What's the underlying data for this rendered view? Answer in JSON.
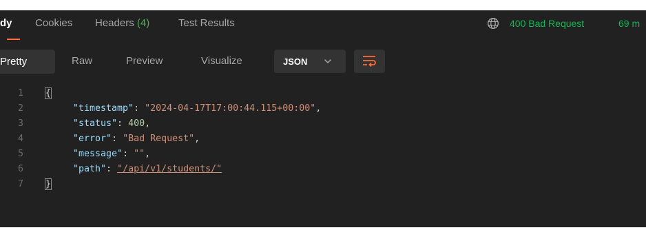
{
  "tabs": {
    "body": "dy",
    "cookies": "Cookies",
    "headers_label": "Headers",
    "headers_count": "(4)",
    "test_results": "Test Results"
  },
  "status": {
    "code_text": "400 Bad Request",
    "time": "69 m"
  },
  "toolbar": {
    "pretty": "Pretty",
    "raw": "Raw",
    "preview": "Preview",
    "visualize": "Visualize",
    "format": "JSON"
  },
  "icons": {
    "globe": "globe-icon",
    "chevron": "chevron-down-icon",
    "wrap": "wrap-lines-icon"
  },
  "colors": {
    "background": "#212121",
    "active_tab_underline": "#ff6c37",
    "status_ok_text": "#0cbb52"
  },
  "code": {
    "line_numbers": [
      "1",
      "2",
      "3",
      "4",
      "5",
      "6",
      "7"
    ],
    "open_brace": "{",
    "close_brace": "}",
    "entries": [
      {
        "key": "\"timestamp\"",
        "value": "\"2024-04-17T17:00:44.115+00:00\"",
        "type": "string",
        "trailing": ","
      },
      {
        "key": "\"status\"",
        "value": "400",
        "type": "number",
        "trailing": ","
      },
      {
        "key": "\"error\"",
        "value": "\"Bad Request\"",
        "type": "string",
        "trailing": ","
      },
      {
        "key": "\"message\"",
        "value": "\"\"",
        "type": "string",
        "trailing": ","
      },
      {
        "key": "\"path\"",
        "value": "\"/api/v1/students/\"",
        "type": "string",
        "trailing": ""
      }
    ]
  }
}
